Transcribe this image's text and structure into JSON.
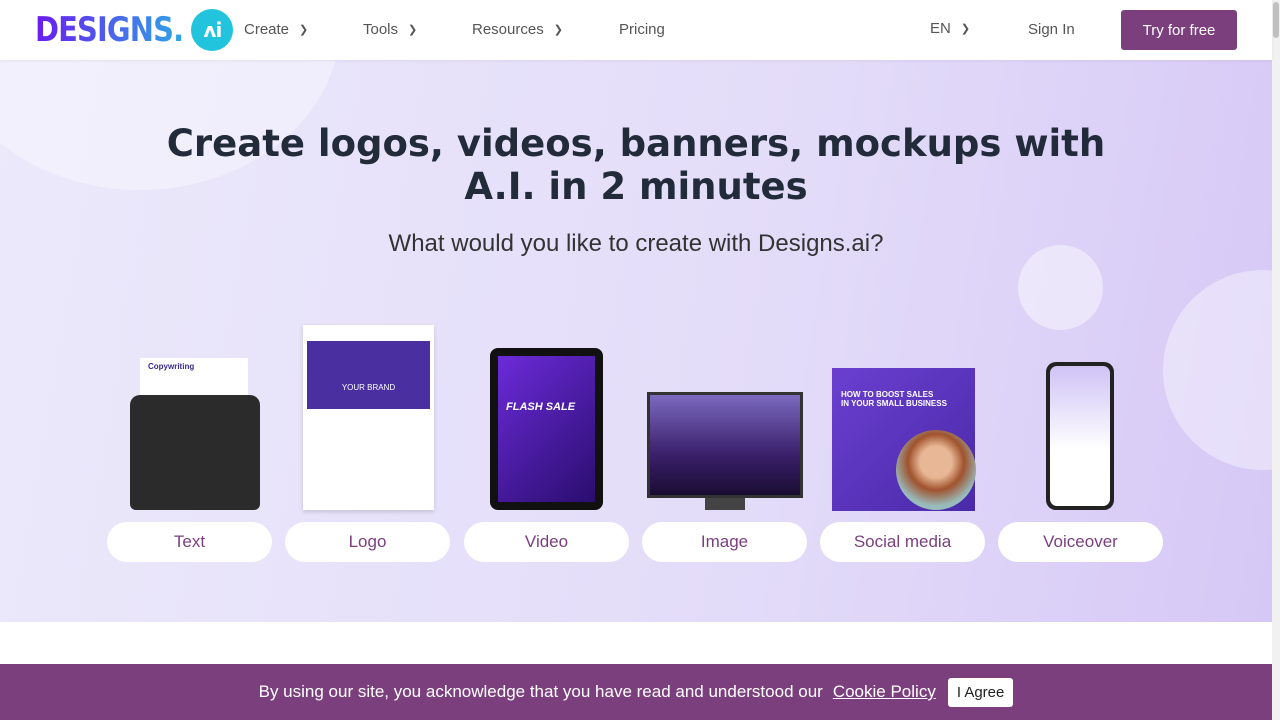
{
  "nav": {
    "logo": "DESIGNS.AI",
    "items": [
      {
        "label": "Create"
      },
      {
        "label": "Tools"
      },
      {
        "label": "Resources"
      },
      {
        "label": "Pricing"
      }
    ],
    "lang": "EN",
    "signin": "Sign In",
    "try": "Try for free"
  },
  "hero": {
    "title": "Create logos, videos, banners, mockups with A.I. in 2 minutes",
    "subtitle": "What would you like to create with Designs.ai?",
    "cards": [
      {
        "label": "Text"
      },
      {
        "label": "Logo"
      },
      {
        "label": "Video"
      },
      {
        "label": "Image"
      },
      {
        "label": "Social media"
      },
      {
        "label": "Voiceover"
      }
    ],
    "art": {
      "copywriting": "Copywriting",
      "brand": "YOUR BRAND",
      "flash": "FLASH SALE",
      "social": "HOW TO BOOST SALES IN YOUR SMALL BUSINESS"
    }
  },
  "cookie": {
    "text": "By using our site, you acknowledge that you have read and understood our",
    "link": "Cookie Policy",
    "agree": "I Agree"
  },
  "colors": {
    "brand": "#7b3f7e",
    "title": "#222b3a"
  }
}
